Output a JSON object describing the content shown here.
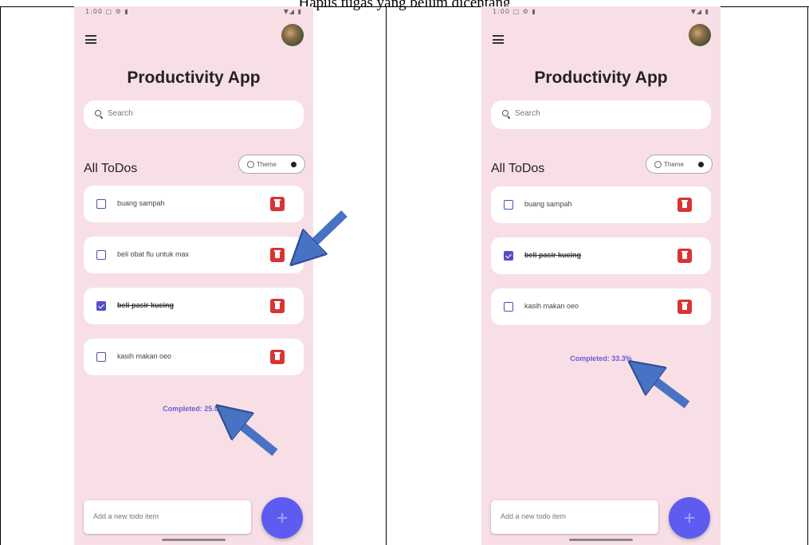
{
  "caption": "Hapus tugas yang belum dicentang",
  "status_bar": {
    "left": "1:00 ▢ ⚙ ▮",
    "right": "▼◢ ▮"
  },
  "app": {
    "title": "Productivity App",
    "search_placeholder": "Search",
    "section_title": "All ToDos",
    "theme_label": "Theme",
    "add_placeholder": "Add a new todo item"
  },
  "before": {
    "todos": [
      {
        "label": "buang sampah",
        "done": false
      },
      {
        "label": "beli obat flu untuk max",
        "done": false
      },
      {
        "label": "beli pasir kucing",
        "done": true
      },
      {
        "label": "kasih makan oeo",
        "done": false
      }
    ],
    "completed": "Completed: 25.0%"
  },
  "after": {
    "todos": [
      {
        "label": "buang sampah",
        "done": false
      },
      {
        "label": "beli pasir kucing",
        "done": true
      },
      {
        "label": "kasih makan oeo",
        "done": false
      }
    ],
    "completed": "Completed: 33.3%"
  },
  "colors": {
    "phone_background": "#f8dfe6",
    "accent": "#5e5cf0",
    "delete": "#d93434",
    "arrow": "#4a72c4"
  }
}
